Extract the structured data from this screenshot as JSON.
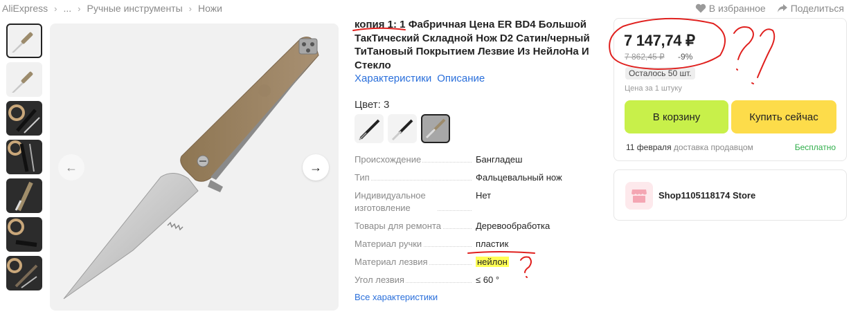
{
  "breadcrumb": {
    "items": [
      "AliExpress",
      "...",
      "Ручные инструменты",
      "Ножи"
    ]
  },
  "header_actions": {
    "favorites": "В избранное",
    "share": "Поделиться"
  },
  "product": {
    "title": "копия 1: 1 Фабричная Цена ER BD4 Большой ТакТический Складной Нож D2 Сатин/черный ТиТановый Покрытием Лезвие Из НейлоНа И Стекло",
    "tabs": [
      "Характеристики",
      "Описание"
    ],
    "color_label": "Цвет: 3",
    "specs": [
      {
        "key": "Происхождение",
        "value": "Бангладеш"
      },
      {
        "key": "Тип",
        "value": "Фальцевальный нож"
      },
      {
        "key": "Индивидуальное изготовление",
        "value": "Нет"
      },
      {
        "key": "Товары для ремонта",
        "value": "Деревообработка"
      },
      {
        "key": "Материал ручки",
        "value": "пластик"
      },
      {
        "key": "Материал лезвия",
        "value": "нейлон"
      },
      {
        "key": "Угол лезвия",
        "value": "≤ 60 °"
      }
    ],
    "all_specs_link": "Все характеристики"
  },
  "price_card": {
    "price": "7 147,74 ₽",
    "old_price": "7 862,45 ₽",
    "discount": "-9%",
    "stock": "Осталось 50 шт.",
    "unit_note": "Цена за 1 штуку",
    "cart_button": "В корзину",
    "buy_button": "Купить сейчас",
    "delivery_date": "11 февраля",
    "delivery_text": "доставка продавцом",
    "delivery_price": "Бесплатно"
  },
  "store": {
    "name": "Shop1105118174 Store"
  },
  "colors": {
    "link": "#2a6fdb",
    "cart_button": "#c8f04a",
    "buy_button": "#fddc4a",
    "free_delivery": "#2fae4a",
    "annotation": "#e0201e",
    "highlight": "#ffff55"
  }
}
